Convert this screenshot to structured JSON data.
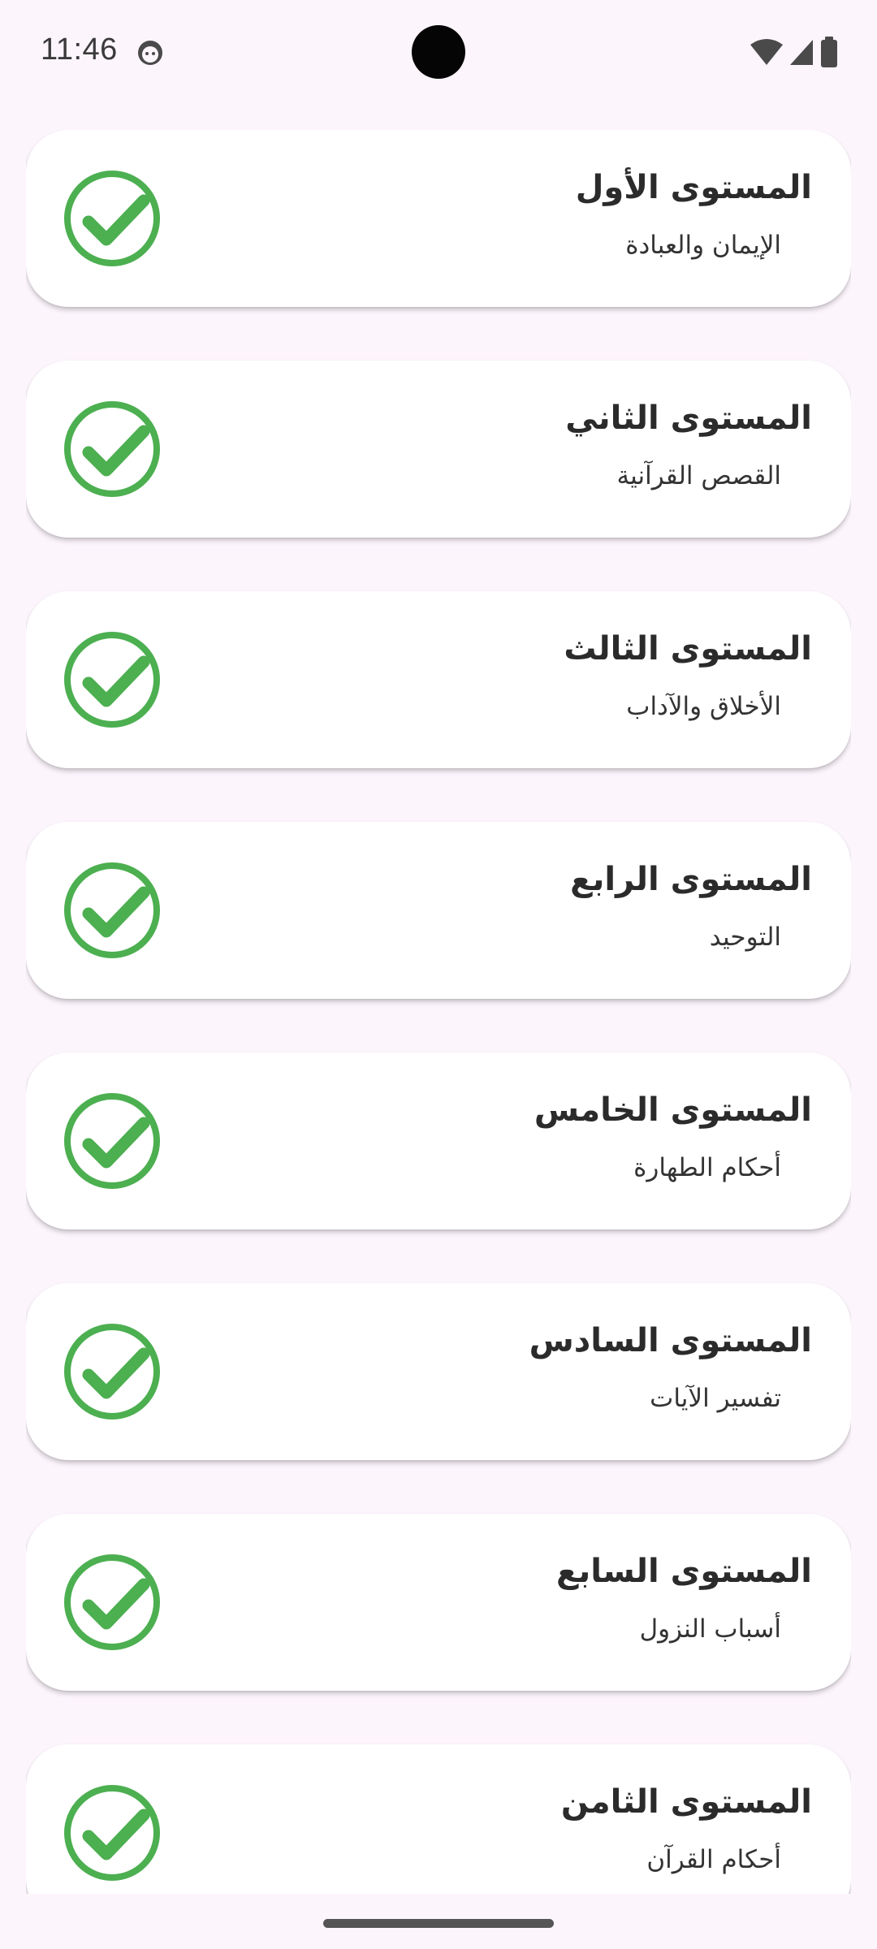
{
  "status_bar": {
    "time": "11:46"
  },
  "levels": [
    {
      "title": "المستوى الأول",
      "subtitle": "الإيمان والعبادة"
    },
    {
      "title": "المستوى الثاني",
      "subtitle": "القصص القرآنية"
    },
    {
      "title": "المستوى الثالث",
      "subtitle": "الأخلاق والآداب"
    },
    {
      "title": "المستوى الرابع",
      "subtitle": "التوحيد"
    },
    {
      "title": "المستوى الخامس",
      "subtitle": "أحكام الطهارة"
    },
    {
      "title": "المستوى السادس",
      "subtitle": "تفسير الآيات"
    },
    {
      "title": "المستوى السابع",
      "subtitle": "أسباب النزول"
    },
    {
      "title": "المستوى الثامن",
      "subtitle": "أحكام القرآن"
    }
  ],
  "colors": {
    "check": "#4caf50",
    "background": "#fcf5fc",
    "card": "#ffffff"
  },
  "icons": {
    "completed": "check-circle-icon"
  }
}
